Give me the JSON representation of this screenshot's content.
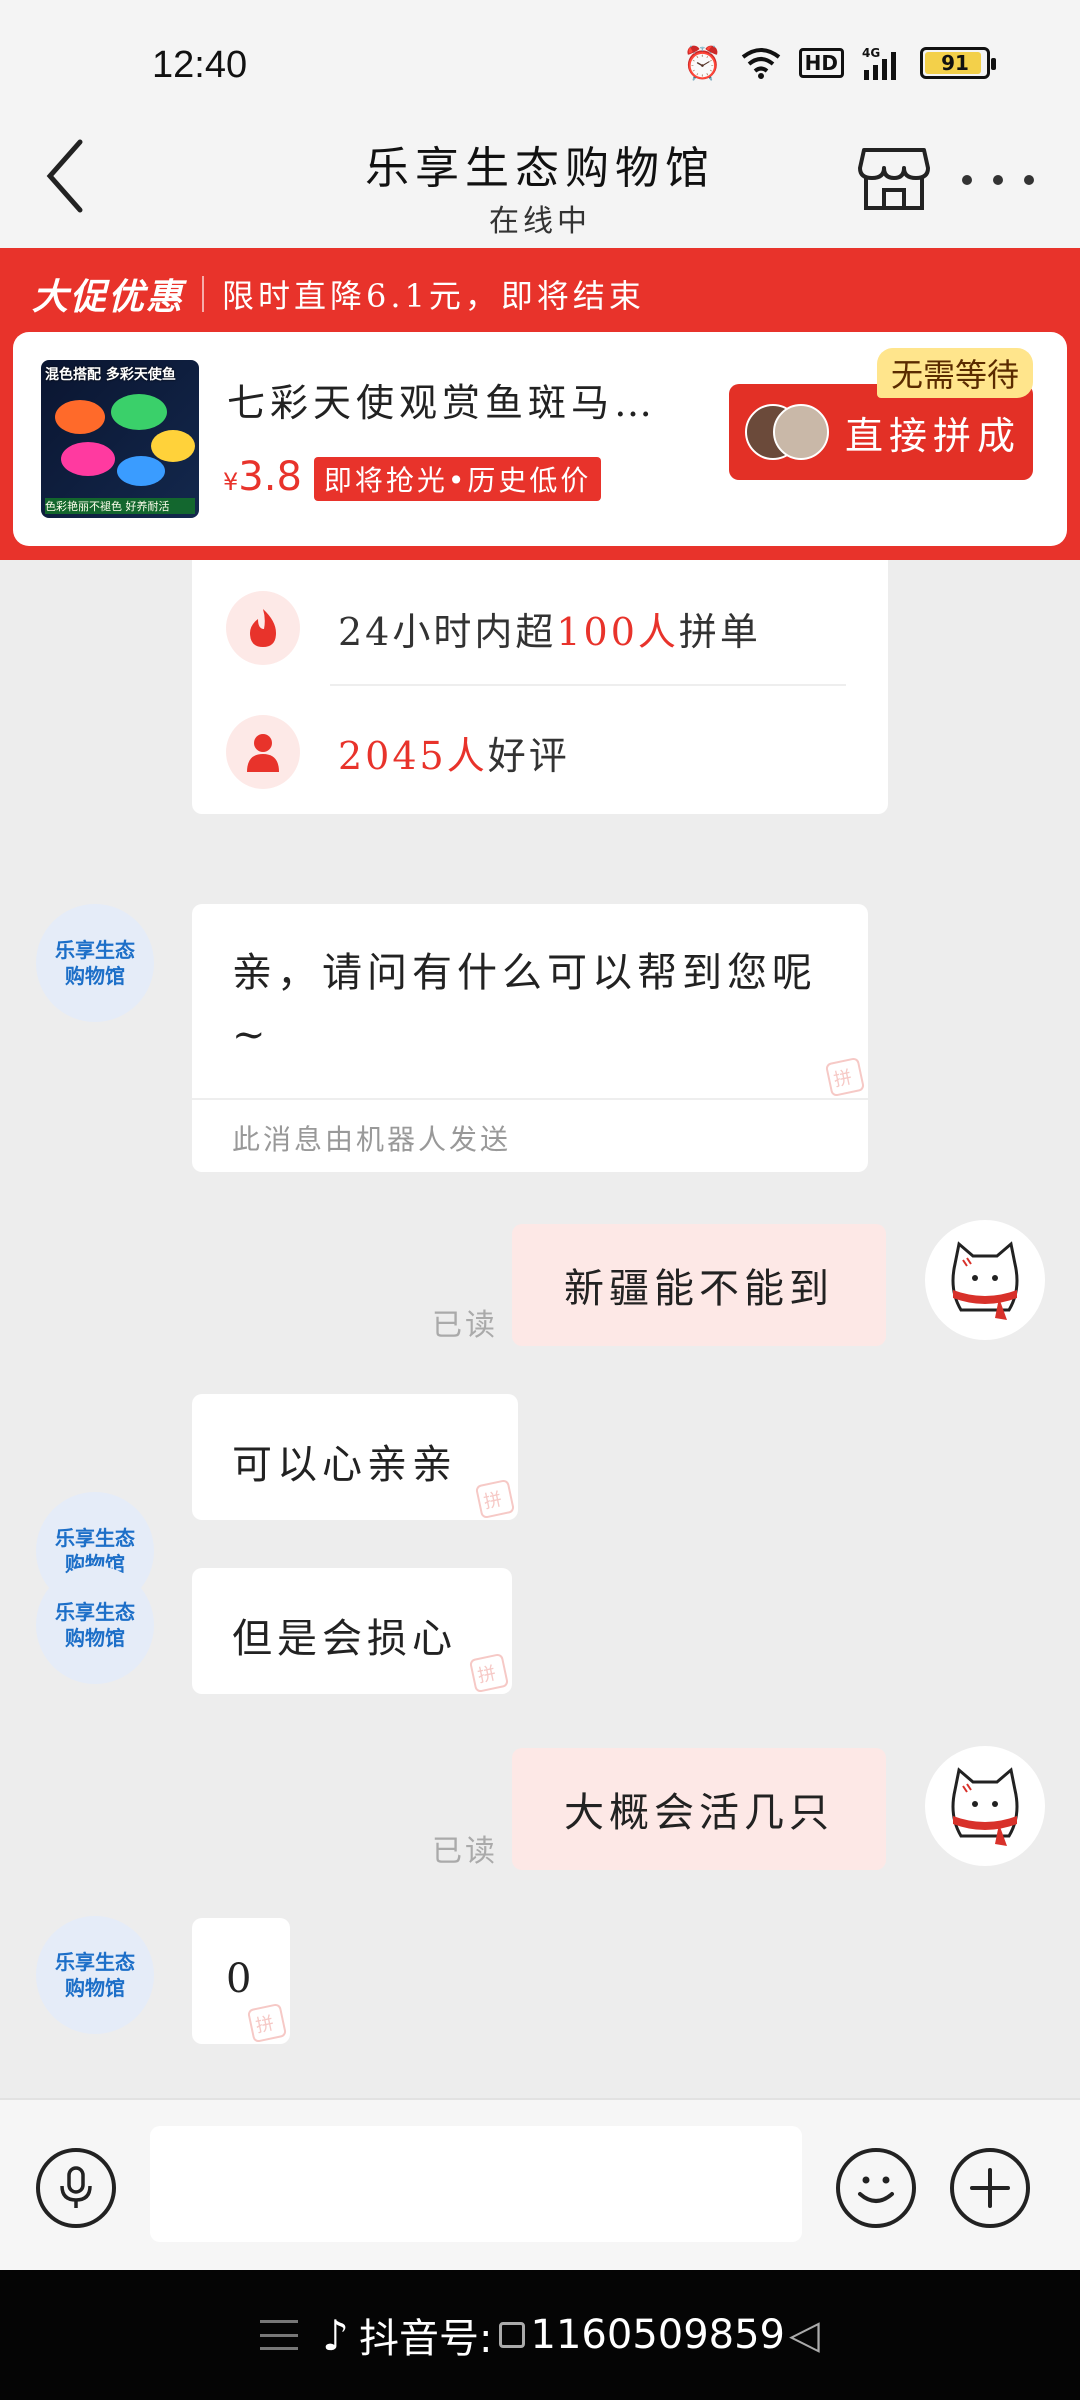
{
  "status_bar": {
    "time": "12:40",
    "icons": [
      "alarm-icon",
      "wifi-icon",
      "hd-icon",
      "signal-4g-icon",
      "battery-icon"
    ],
    "hd_label": "HD",
    "network_label": "4G",
    "battery_level": "91"
  },
  "header": {
    "title": "乐享生态购物馆",
    "subtitle": "在线中"
  },
  "promo": {
    "title": "大促优惠",
    "description": "限时直降6.1元，即将结束",
    "product": {
      "image_caption_top": "混色搭配 多彩天使鱼",
      "image_caption_bottom": "色彩艳丽不褪色  好养耐活",
      "name": "七彩天使观赏鱼斑马…",
      "currency": "¥",
      "price": "3.8",
      "price_tag": "即将抢光•历史低价"
    },
    "join_button": "直接拼成",
    "badge": "无需等待"
  },
  "info_card": {
    "row1": {
      "prefix": "24小时内超",
      "highlight": "100人",
      "suffix": "拼单"
    },
    "row2": {
      "highlight": "2045人",
      "suffix": "好评"
    }
  },
  "shop_avatar": {
    "line1": "乐享生态",
    "line2": "购物馆"
  },
  "messages": [
    {
      "side": "in",
      "text": "亲，请问有什么可以帮到您呢~",
      "note": "此消息由机器人发送"
    },
    {
      "side": "out",
      "text": "新疆能不能到",
      "status": "已读"
    },
    {
      "side": "in",
      "text": "可以心亲亲"
    },
    {
      "side": "in",
      "text": "但是会损心"
    },
    {
      "side": "out",
      "text": "大概会活几只",
      "status": "已读"
    },
    {
      "side": "in",
      "text": "0"
    }
  ],
  "bubble_mark": "拼",
  "input": {
    "placeholder": ""
  },
  "nav_bar": {
    "label": "抖音号:",
    "id": "1160509859",
    "back": "◁"
  },
  "colors": {
    "accent": "#e8332b",
    "badge": "#ffe58c",
    "out_bubble": "#fde8e6",
    "shop_avatar_text": "#1d6fc8"
  }
}
